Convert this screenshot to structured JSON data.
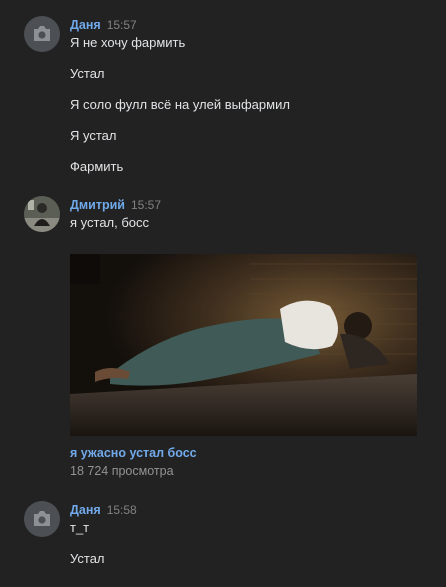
{
  "messages": [
    {
      "author": "Даня",
      "time": "15:57",
      "avatar_icon": "camera-icon",
      "lines": [
        "Я не хочу фармить",
        "Устал",
        "Я соло фулл всё на улей выфармил",
        "Я устал",
        "Фармить"
      ]
    },
    {
      "author": "Дмитрий",
      "time": "15:57",
      "avatar_icon": "user-photo",
      "lines": [
        "я устал, босс"
      ],
      "attachment": {
        "type": "video",
        "title": "я ужасно устал босс",
        "views": "18 724 просмотра"
      }
    },
    {
      "author": "Даня",
      "time": "15:58",
      "avatar_icon": "camera-icon",
      "lines": [
        "т_т",
        "Устал"
      ]
    }
  ],
  "colors": {
    "background": "#222222",
    "author": "#71aaeb",
    "text": "#e1e3e6",
    "meta": "#828282"
  }
}
